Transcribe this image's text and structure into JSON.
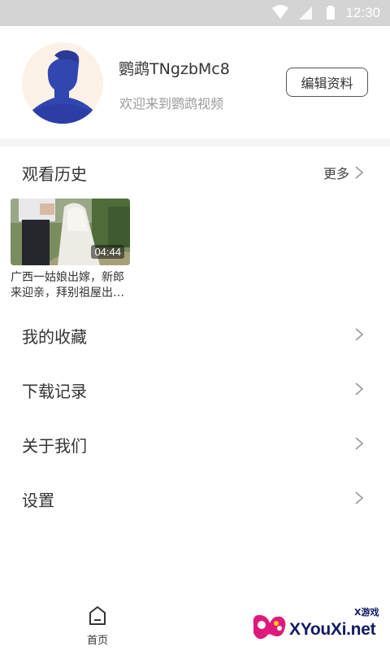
{
  "status_bar": {
    "time": "12:30"
  },
  "profile": {
    "username": "鹦鹉TNgzbMc8",
    "welcome": "欢迎来到鹦鹉视频",
    "edit_label": "编辑资料"
  },
  "history": {
    "title": "观看历史",
    "more_label": "更多",
    "videos": [
      {
        "duration": "04:44",
        "title": "广西一姑娘出嫁，新郎来迎亲，拜别祖屋出…"
      }
    ]
  },
  "menu": [
    {
      "label": "我的收藏"
    },
    {
      "label": "下载记录"
    },
    {
      "label": "关于我们"
    },
    {
      "label": "设置"
    }
  ],
  "bottom_nav": {
    "home_label": "首页"
  },
  "watermark": {
    "brand": "XYouXi.net",
    "small": "X游戏"
  }
}
